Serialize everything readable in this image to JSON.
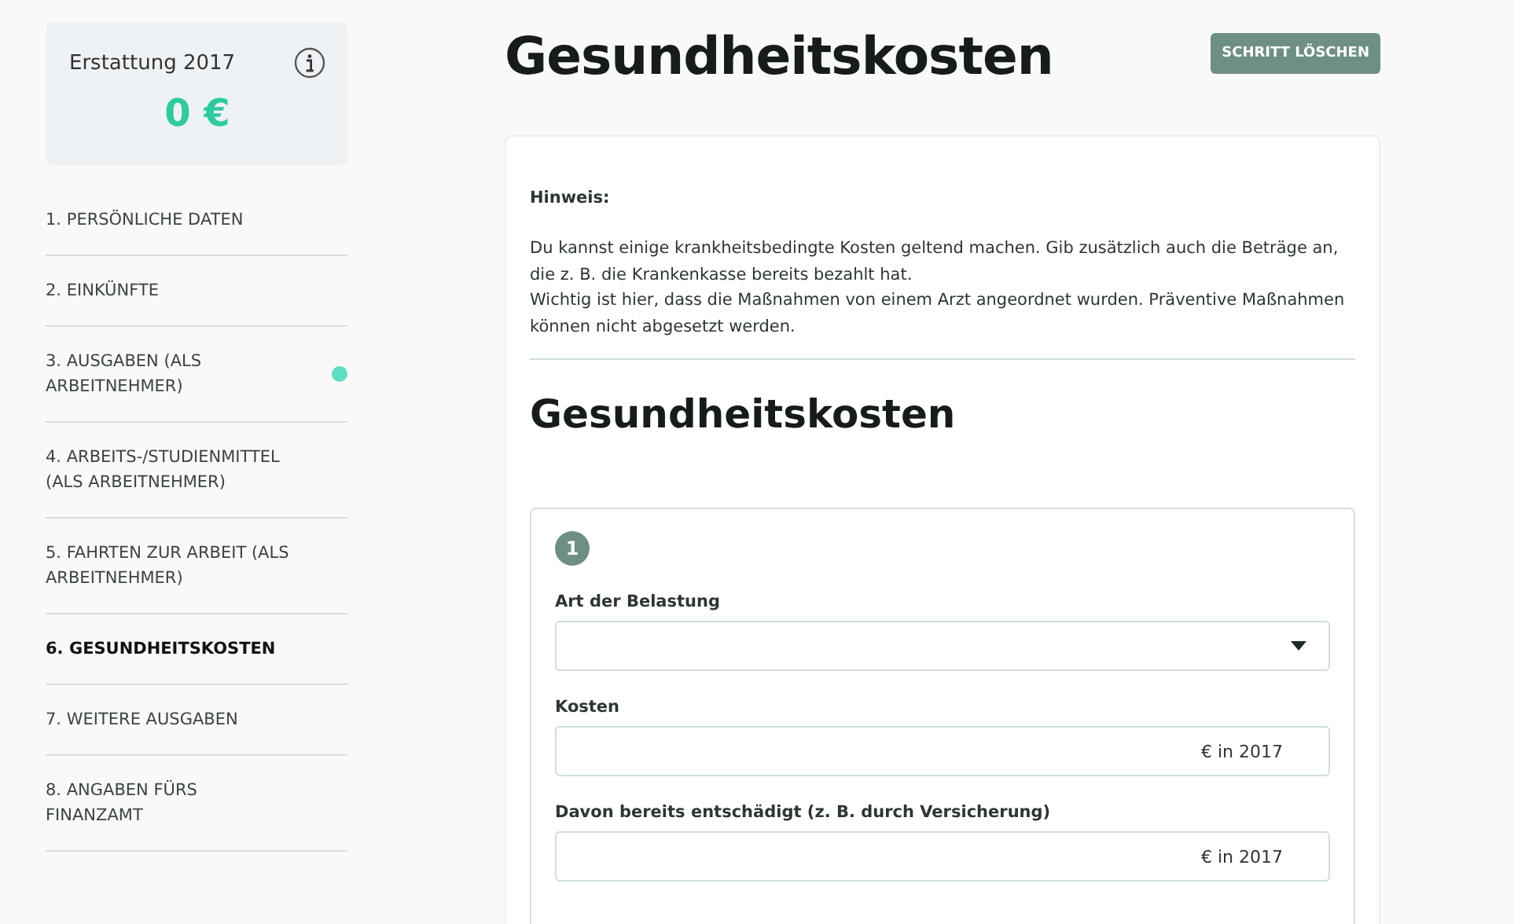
{
  "refund": {
    "label": "Erstattung 2017",
    "amount": "0 €"
  },
  "steps": [
    {
      "label": "1. PERSÖNLICHE DATEN",
      "selected": false,
      "marked": false
    },
    {
      "label": "2. EINKÜNFTE",
      "selected": false,
      "marked": false
    },
    {
      "label": "3. AUSGABEN (ALS ARBEITNEHMER)",
      "selected": false,
      "marked": true
    },
    {
      "label": "4. ARBEITS-/STUDIENMITTEL (ALS ARBEITNEHMER)",
      "selected": false,
      "marked": false
    },
    {
      "label": "5. FAHRTEN ZUR ARBEIT (ALS ARBEITNEHMER)",
      "selected": false,
      "marked": false
    },
    {
      "label": "6. GESUNDHEITSKOSTEN",
      "selected": true,
      "marked": false
    },
    {
      "label": "7. WEITERE AUSGABEN",
      "selected": false,
      "marked": false
    },
    {
      "label": "8. ANGABEN FÜRS FINANZAMT",
      "selected": false,
      "marked": false
    }
  ],
  "page_title": "Gesundheitskosten",
  "delete_button": "SCHRITT LÖSCHEN",
  "notice": {
    "heading": "Hinweis:",
    "paragraphs": [
      "Du kannst einige krankheitsbedingte Kosten geltend machen. Gib zusätzlich auch die Beträge an, die z. B. die Krankenkasse bereits bezahlt hat.",
      "Wichtig ist hier, dass die Maßnahmen von einem Arzt angeordnet wurden. Präventive Maßnahmen können nicht abgesetzt werden."
    ]
  },
  "section_title": "Gesundheitskosten",
  "entry": {
    "number": "1",
    "fields": [
      {
        "kind": "select",
        "label": "Art der Belastung"
      },
      {
        "kind": "amount",
        "label": "Kosten",
        "unit": "€ in 2017"
      },
      {
        "kind": "amount",
        "label": "Davon bereits entschädigt (z. B. durch Versicherung)",
        "unit": "€ in 2017"
      }
    ]
  }
}
